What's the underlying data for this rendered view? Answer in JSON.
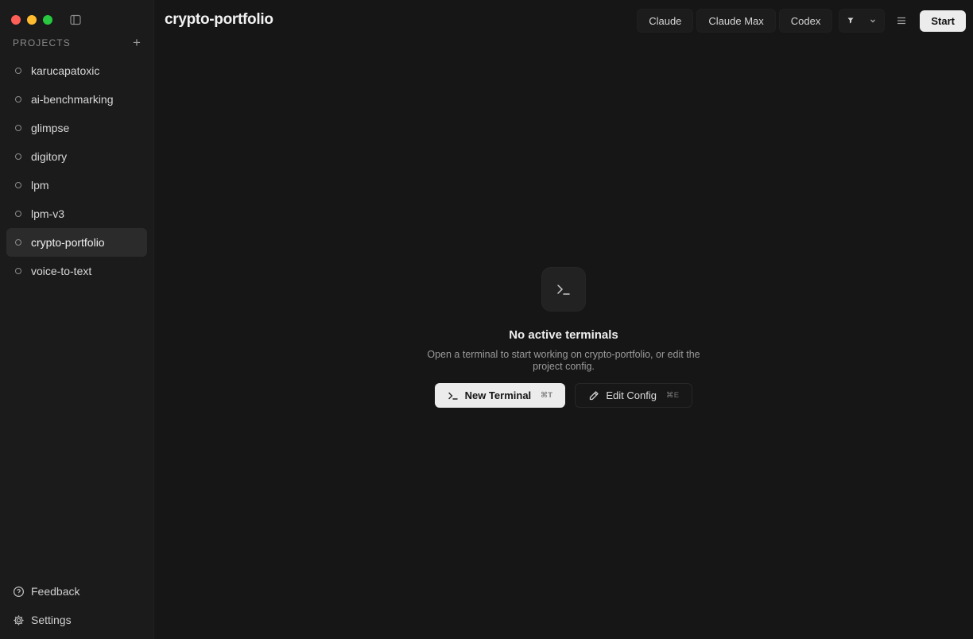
{
  "window": {
    "title": "crypto-portfolio"
  },
  "sidebar": {
    "projects_label": "PROJECTS",
    "add_symbol": "+",
    "items": [
      {
        "label": "karucapatoxic",
        "active": false
      },
      {
        "label": "ai-benchmarking",
        "active": false
      },
      {
        "label": "glimpse",
        "active": false
      },
      {
        "label": "digitory",
        "active": false
      },
      {
        "label": "lpm",
        "active": false
      },
      {
        "label": "lpm-v3",
        "active": false
      },
      {
        "label": "crypto-portfolio",
        "active": true
      },
      {
        "label": "voice-to-text",
        "active": false
      }
    ],
    "footer": {
      "feedback_label": "Feedback",
      "settings_label": "Settings"
    }
  },
  "toolbar": {
    "tabs": [
      "Claude",
      "Claude Max",
      "Codex"
    ],
    "start_label": "Start"
  },
  "empty_state": {
    "title": "No active terminals",
    "description": "Open a terminal to start working on crypto-portfolio, or edit the project config.",
    "new_terminal_label": "New Terminal",
    "new_terminal_shortcut": "⌘T",
    "edit_config_label": "Edit Config",
    "edit_config_shortcut": "⌘E"
  },
  "colors": {
    "background": "#161616",
    "sidebar": "#1b1b1b",
    "active_item": "#2b2b2b",
    "primary_button": "#ececec"
  },
  "icons": [
    "sidebar-toggle-icon",
    "plus-icon",
    "circle-status-icon",
    "help-circle-icon",
    "gear-icon",
    "pin-icon",
    "chevron-down-icon",
    "menu-icon",
    "terminal-icon",
    "pencil-icon"
  ]
}
